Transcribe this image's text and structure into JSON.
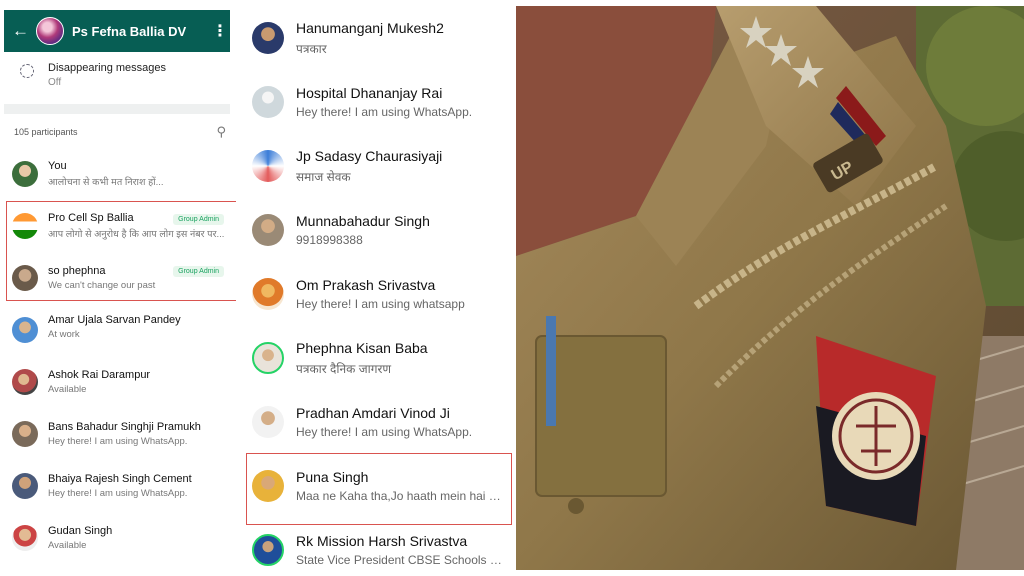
{
  "group": {
    "title": "Ps Fefna Ballia DV",
    "back_icon": "arrow-left-icon",
    "menu_icon": "more-vertical-icon"
  },
  "disappearing": {
    "label": "Disappearing messages",
    "value": "Off"
  },
  "participants": {
    "count_label": "105 participants",
    "admin_badge": "Group Admin",
    "items": [
      {
        "name": "You",
        "status": "आलोचना से कभी मत निराश हों...",
        "admin": false
      },
      {
        "name": "Pro Cell Sp Ballia",
        "status": "आप लोगो से अनुरोध है कि आप लोग इस नंबर पर...",
        "admin": true
      },
      {
        "name": "so phephna",
        "status": "We can't change our past",
        "admin": true
      },
      {
        "name": "Amar Ujala Sarvan Pandey",
        "status": "At work",
        "admin": false
      },
      {
        "name": "Ashok Rai Darampur",
        "status": "Available",
        "admin": false
      },
      {
        "name": "Bans Bahadur Singhji Pramukh",
        "status": "Hey there! I am using WhatsApp.",
        "admin": false
      },
      {
        "name": "Bhaiya Rajesh Singh Cement",
        "status": "Hey there! I am using WhatsApp.",
        "admin": false
      },
      {
        "name": "Gudan Singh",
        "status": "Available",
        "admin": false
      }
    ]
  },
  "contacts": [
    {
      "name": "Hanumanganj Mukesh2",
      "status": "पत्रकार"
    },
    {
      "name": "Hospital Dhananjay Rai",
      "status": "Hey there! I am using WhatsApp."
    },
    {
      "name": "Jp Sadasy Chaurasiyaji",
      "status": "समाज सेवक"
    },
    {
      "name": "Munnabahadur Singh",
      "status": "9918998388"
    },
    {
      "name": "Om Prakash Srivastva",
      "status": "Hey there! I am using whatsapp"
    },
    {
      "name": "Phephna Kisan Baba",
      "status": "पत्रकार दैनिक जागरण"
    },
    {
      "name": "Pradhan Amdari Vinod Ji",
      "status": "Hey there! I am using WhatsApp."
    },
    {
      "name": "Puna Singh",
      "status": "Maa ne Kaha tha,Jo haath mein hai uss..."
    },
    {
      "name": "Rk Mission Harsh Srivastva",
      "status": "State Vice President CBSE Schools Ma..."
    }
  ],
  "photo": {
    "badge_text": "UP"
  }
}
